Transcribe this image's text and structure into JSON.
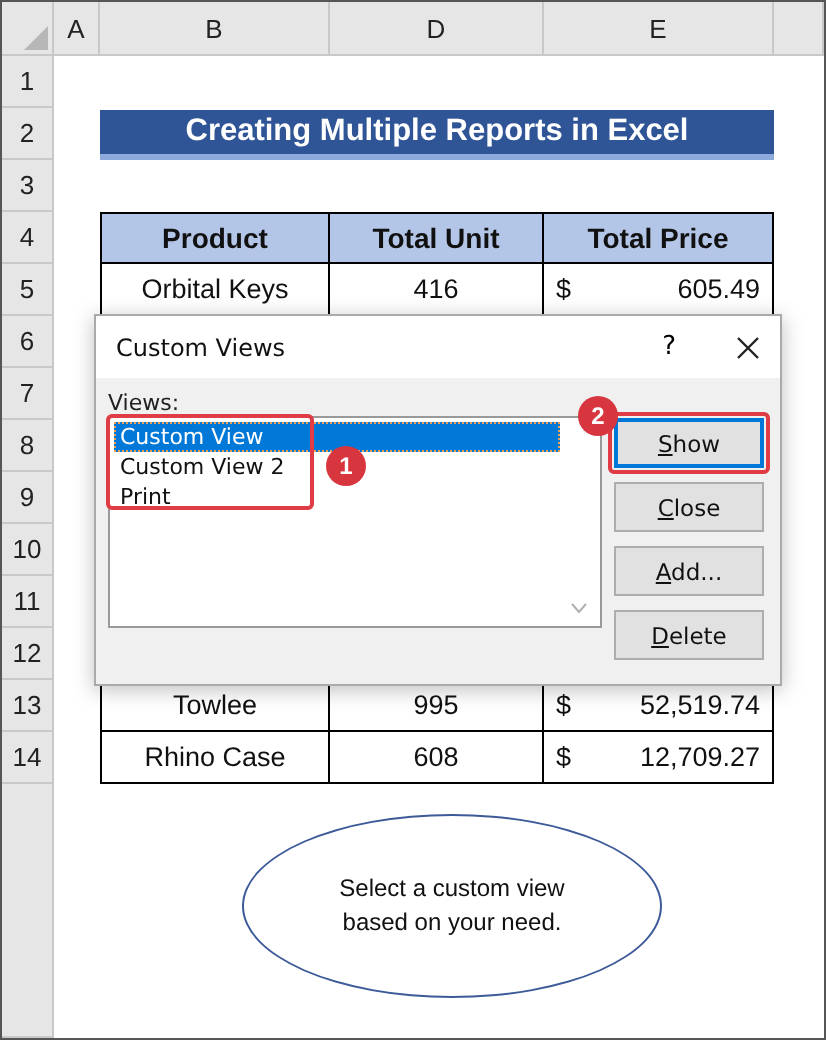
{
  "columns": [
    "A",
    "B",
    "D",
    "E"
  ],
  "rows": [
    {
      "number": "1",
      "kind": "empty"
    },
    {
      "number": "2",
      "kind": "title",
      "text": "Creating Multiple Reports in Excel"
    },
    {
      "number": "3",
      "kind": "empty"
    },
    {
      "number": "4",
      "kind": "header",
      "cells": [
        "Product",
        "Total Unit",
        "Total Price"
      ]
    },
    {
      "number": "5",
      "kind": "data",
      "product": "Orbital Keys",
      "unit": "416",
      "currency": "$",
      "price": "605.49"
    },
    {
      "number": "6",
      "kind": "empty"
    },
    {
      "number": "7",
      "kind": "empty"
    },
    {
      "number": "8",
      "kind": "empty"
    },
    {
      "number": "9",
      "kind": "empty"
    },
    {
      "number": "10",
      "kind": "empty"
    },
    {
      "number": "11",
      "kind": "empty"
    },
    {
      "number": "12",
      "kind": "empty"
    },
    {
      "number": "13",
      "kind": "data",
      "product": "Towlee",
      "unit": "995",
      "currency": "$",
      "price": "52,519.74"
    },
    {
      "number": "14",
      "kind": "data",
      "product": "Rhino Case",
      "unit": "608",
      "currency": "$",
      "price": "12,709.27"
    }
  ],
  "dialog": {
    "title": "Custom Views",
    "help": "?",
    "views_label": "Views:",
    "items": [
      {
        "label": "Custom View",
        "selected": true
      },
      {
        "label": "Custom View 2",
        "selected": false
      },
      {
        "label": "Print",
        "selected": false
      }
    ],
    "buttons": [
      {
        "label": "Show",
        "default": true,
        "underline_first": true
      },
      {
        "label": "Close",
        "default": false,
        "underline_first": true
      },
      {
        "label": "Add...",
        "default": false,
        "underline_first": true
      },
      {
        "label": "Delete",
        "default": false,
        "underline_first": true
      }
    ],
    "markers": [
      "1",
      "2"
    ]
  },
  "callout": {
    "text": "Select a custom view based on your need."
  }
}
